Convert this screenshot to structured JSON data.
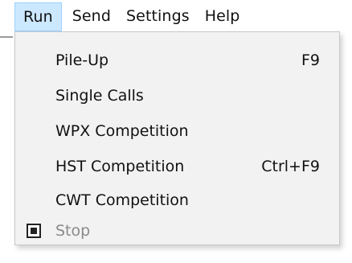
{
  "menubar": {
    "items": [
      {
        "label": "Run"
      },
      {
        "label": "Send"
      },
      {
        "label": "Settings"
      },
      {
        "label": "Help"
      }
    ]
  },
  "run_menu": {
    "items": [
      {
        "label": "Pile-Up",
        "shortcut": "F9"
      },
      {
        "label": "Single Calls",
        "shortcut": ""
      },
      {
        "label": "WPX Competition",
        "shortcut": ""
      },
      {
        "label": "HST Competition",
        "shortcut": "Ctrl+F9"
      },
      {
        "label": "CWT Competition",
        "shortcut": ""
      },
      {
        "label": "Stop",
        "shortcut": "",
        "icon": "stop-icon",
        "disabled": true
      }
    ]
  },
  "colors": {
    "menubar_active_bg": "#cce8ff",
    "menubar_active_border": "#99d1ff",
    "dropdown_bg": "#f2f2f2",
    "disabled_text": "#8a8a8a"
  }
}
